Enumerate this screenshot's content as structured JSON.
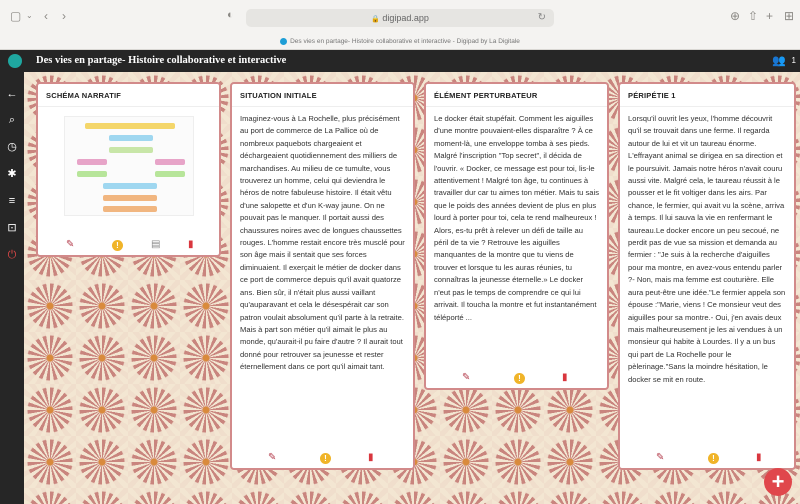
{
  "browser": {
    "url": "digipad.app",
    "tab_title": "Des vies en partage- Histoire collaborative et interactive - Digipad by La Digitale"
  },
  "app": {
    "title": "Des vies en partage- Histoire collaborative et interactive",
    "user_count": "1"
  },
  "columns": [
    {
      "title": "SCHÉMA NARRATIF",
      "text": ""
    },
    {
      "title": "SITUATION INITIALE",
      "text": "Imaginez-vous à La Rochelle, plus précisément au port de commerce de La Pallice où de nombreux paquebots chargeaient et déchargeaient quotidiennement des milliers de marchandises. Au milieu de ce tumulte, vous trouverez un homme, celui qui deviendra le héros de notre fabuleuse histoire. Il était vêtu d'une salopette et d'un K-way jaune. On ne pouvait pas le manquer. Il portait aussi des chaussures noires avec de longues chaussettes rouges. L'homme restait encore très musclé pour son âge mais il sentait que ses forces diminuaient. Il exerçait le métier de docker dans ce port de commerce depuis qu'il avait quatorze ans. Bien sûr, il n'était plus aussi vaillant qu'auparavant et cela le désespérait car son patron voulait absolument qu'il parte à la retraite. Mais à part son métier qu'il aimait le plus au monde, qu'aurait-il pu faire d'autre ? Il aurait tout donné pour retrouver sa jeunesse et rester éternellement dans ce port qu'il aimait tant."
    },
    {
      "title": "ÉLÉMENT PERTURBATEUR",
      "text": "Le docker était stupéfait. Comment les aiguilles d'une montre pouvaient-elles disparaître ? À ce moment-là, une enveloppe tomba à ses pieds. Malgré l'inscription \"Top secret\", il décida de l'ouvrir. « Docker, ce message est pour toi, lis-le attentivement ! Malgré ton âge, tu continues à travailler dur car tu aimes ton métier. Mais tu sais que le poids des années devient de plus en plus lourd à porter pour toi, cela te rend malheureux ! Alors, es-tu prêt à relever un défi de taille au péril de ta vie ? Retrouve les aiguilles manquantes de la montre que tu viens de trouver et lorsque tu les auras réunies, tu connaîtras la jeunesse éternelle.» Le docker n'eut pas le temps de comprendre ce qui lui arrivait. Il toucha la montre et fut instantanément téléporté ..."
    },
    {
      "title": "PÉRIPÉTIE 1",
      "text": "Lorsqu'il ouvrit les yeux, l'homme découvrit qu'il se trouvait dans une ferme. Il regarda autour de lui et vit un taureau énorme. L'effrayant animal se dirigea en sa direction et le poursuivit. Jamais notre héros n'avait couru aussi vite. Malgré cela, le taureau réussit à le pousser et le fit voltiger dans les airs. Par chance, le fermier, qui avait vu la scène, arriva à temps. Il lui sauva la vie en renfermant le taureau.Le docker encore un peu secoué, ne perdit pas de vue sa mission et demanda au fermier : \"Je suis à la recherche d'aiguilles pour ma montre, en avez-vous entendu parler ?- Non, mais ma femme est couturière. Elle aura peut-être une idée.\"Le fermier appela son épouse :\"Marie, viens ! Ce monsieur veut des aiguilles pour sa montre.- Oui, j'en avais deux mais malheureusement je les ai vendues à un monsieur qui habite à Lourdes. Il y a un bus qui part de La Rochelle pour le pèlerinage.\"Sans la moindre hésitation, le docker se mit en route."
    }
  ],
  "colors": {
    "header_bg": "#262626",
    "accent": "#d28a8a",
    "fab": "#e0474c"
  }
}
